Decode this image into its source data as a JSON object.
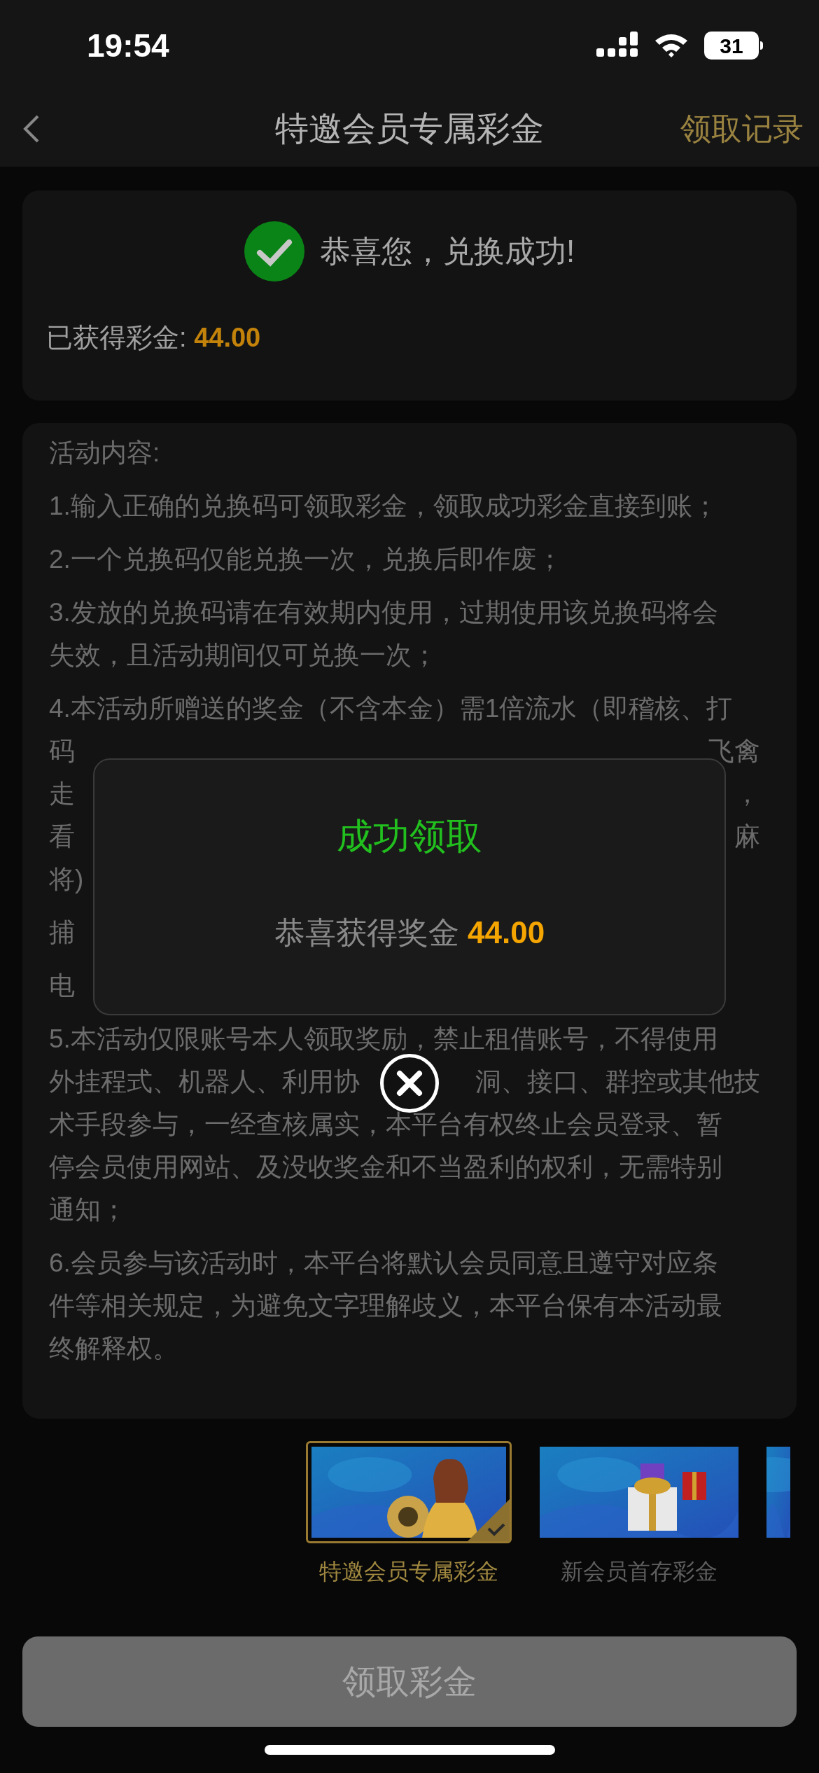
{
  "status_bar": {
    "time": "19:54",
    "battery": "31"
  },
  "nav": {
    "title": "特邀会员专属彩金",
    "action": "领取记录"
  },
  "result_card": {
    "message": "恭喜您，兑换成功!",
    "label": "已获得彩金:",
    "amount": "44.00"
  },
  "rules": {
    "heading": "活动内容:",
    "items": [
      {
        "lines": [
          {
            "left": "1.输入正确的兑换码可领取彩金，领取成功彩金直接到账；"
          }
        ]
      },
      {
        "lines": [
          {
            "left": "2.一个兑换码仅能兑换一次，兑换后即作废；"
          }
        ]
      },
      {
        "lines": [
          {
            "left": "3.发放的兑换码请在有效期内使用，过期使用该兑换码将会"
          },
          {
            "left": "失效，且活动期间仅可兑换一次；"
          }
        ]
      },
      {
        "lines": [
          {
            "left": "4.本活动所赠送的奖金（不含本金）需1倍流水（即稽核、打"
          },
          {
            "left": "码",
            "right": "飞禽"
          },
          {
            "left": "走",
            "right": "，"
          },
          {
            "left": "看",
            "right": "麻"
          },
          {
            "left": "将)"
          }
        ]
      },
      {
        "lines": [
          {
            "left": "捕"
          }
        ]
      },
      {
        "lines": [
          {
            "left": "电"
          }
        ]
      },
      {
        "lines": [
          {
            "left": "5.本活动仅限账号本人领取奖励，禁止租借账号，不得使用"
          },
          {
            "left": "外挂程式、机器人、利用协",
            "right": "洞、接口、群控或其他技"
          },
          {
            "left": "术手段参与，一经查核属实，本平台有权终止会员登录、暂"
          },
          {
            "left": "停会员使用网站、及没收奖金和不当盈利的权利，无需特别"
          },
          {
            "left": "通知；"
          }
        ]
      },
      {
        "lines": [
          {
            "left": "6.会员参与该活动时，本平台将默认会员同意且遵守对应条"
          },
          {
            "left": "件等相关规定，为避免文字理解歧义，本平台保有本活动最"
          },
          {
            "left": "终解释权。"
          }
        ]
      }
    ]
  },
  "dialog": {
    "title": "成功领取",
    "message": "恭喜获得奖金",
    "amount": "44.00"
  },
  "promotions": [
    {
      "label": "特邀会员专属彩金",
      "selected": true
    },
    {
      "label": "新会员首存彩金",
      "selected": false
    },
    {
      "selected": false
    }
  ],
  "claim_button": "领取彩金"
}
